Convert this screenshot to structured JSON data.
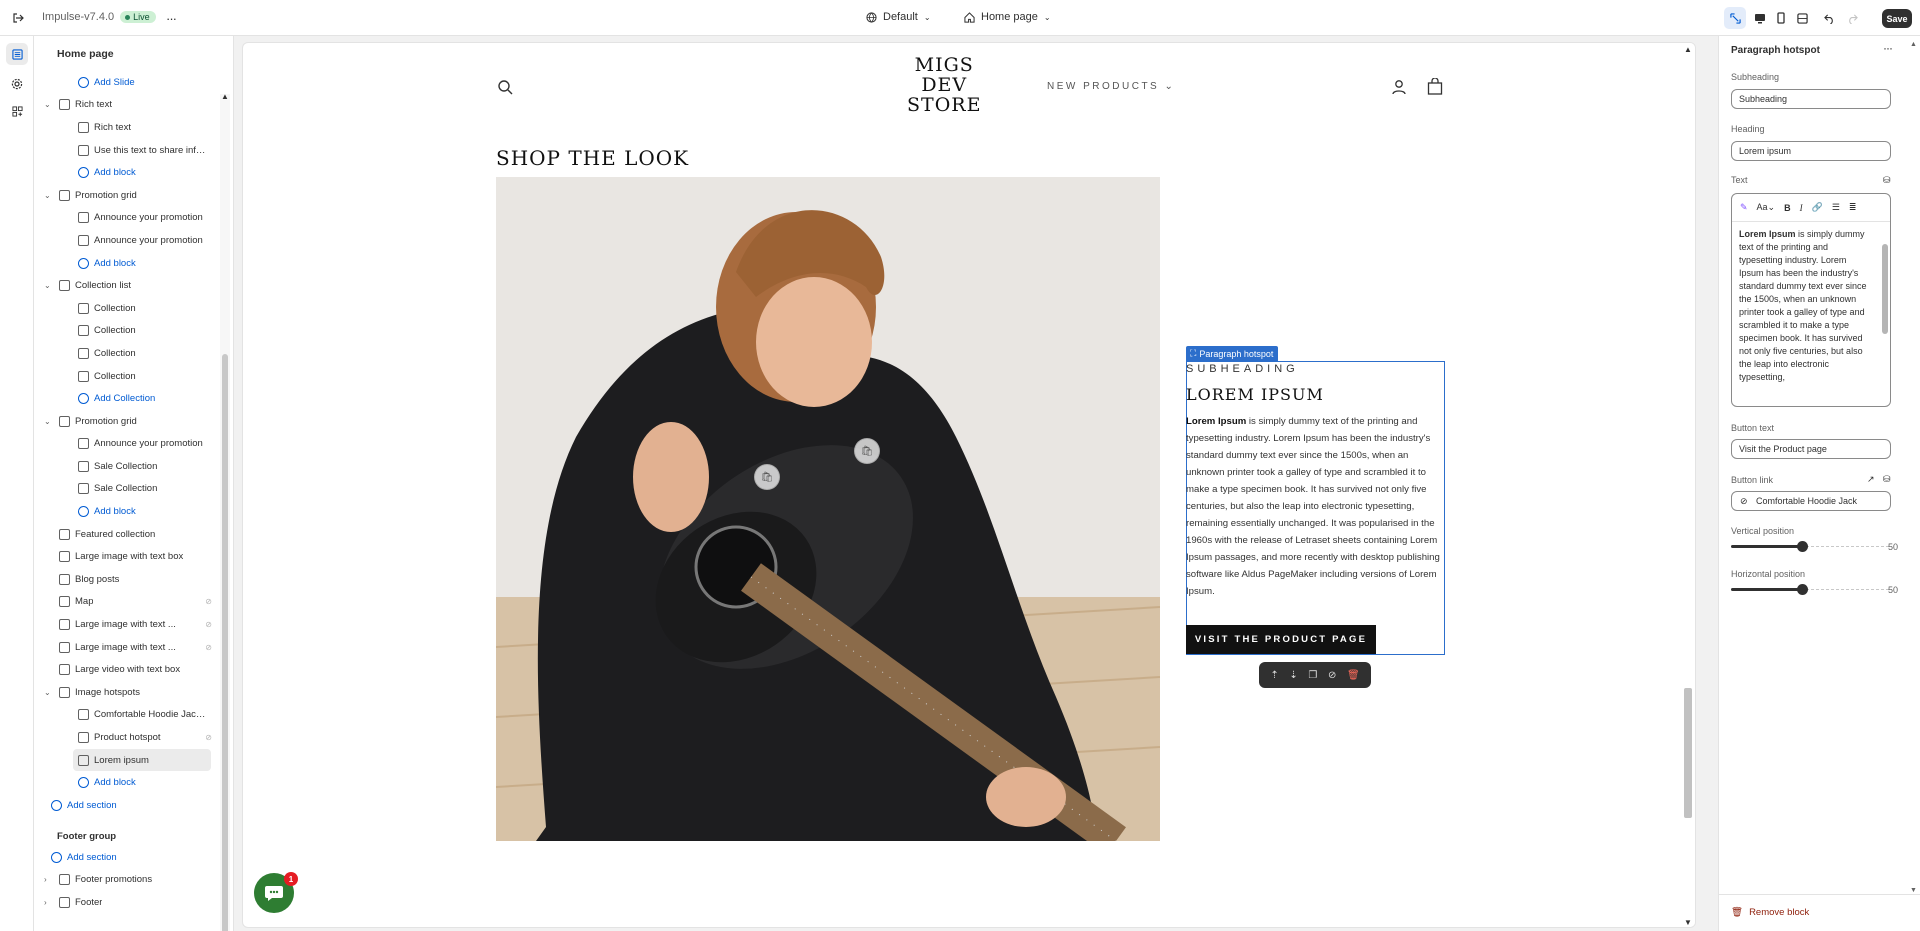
{
  "topbar": {
    "theme_name": "Impulse-v7.4.0",
    "live_badge": "Live",
    "locale": "Default",
    "page_select": "Home page",
    "save_label": "Save"
  },
  "sidebar": {
    "title": "Home page",
    "tree": [
      {
        "level": 2,
        "kind": "add",
        "label": "Add Slide"
      },
      {
        "level": 1,
        "kind": "section",
        "label": "Rich text",
        "expanded": true
      },
      {
        "level": 2,
        "kind": "block",
        "label": "Rich text"
      },
      {
        "level": 2,
        "kind": "block",
        "label": "Use this text to share info..."
      },
      {
        "level": 2,
        "kind": "add",
        "label": "Add block"
      },
      {
        "level": 1,
        "kind": "section",
        "label": "Promotion grid",
        "expanded": true
      },
      {
        "level": 2,
        "kind": "block",
        "label": "Announce your promotion"
      },
      {
        "level": 2,
        "kind": "block",
        "label": "Announce your promotion"
      },
      {
        "level": 2,
        "kind": "add",
        "label": "Add block"
      },
      {
        "level": 1,
        "kind": "section",
        "label": "Collection list",
        "expanded": true
      },
      {
        "level": 2,
        "kind": "block",
        "label": "Collection"
      },
      {
        "level": 2,
        "kind": "block",
        "label": "Collection"
      },
      {
        "level": 2,
        "kind": "block",
        "label": "Collection"
      },
      {
        "level": 2,
        "kind": "block",
        "label": "Collection"
      },
      {
        "level": 2,
        "kind": "add",
        "label": "Add Collection"
      },
      {
        "level": 1,
        "kind": "section",
        "label": "Promotion grid",
        "expanded": true
      },
      {
        "level": 2,
        "kind": "block",
        "label": "Announce your promotion"
      },
      {
        "level": 2,
        "kind": "block",
        "label": "Sale Collection"
      },
      {
        "level": 2,
        "kind": "block",
        "label": "Sale Collection"
      },
      {
        "level": 2,
        "kind": "add",
        "label": "Add block"
      },
      {
        "level": 1,
        "kind": "section-flat",
        "label": "Featured collection"
      },
      {
        "level": 1,
        "kind": "section-flat",
        "label": "Large image with text box"
      },
      {
        "level": 1,
        "kind": "section-flat",
        "label": "Blog posts"
      },
      {
        "level": 1,
        "kind": "section-flat",
        "label": "Map",
        "hidden": true
      },
      {
        "level": 1,
        "kind": "section-flat",
        "label": "Large image with text ...",
        "hidden": true
      },
      {
        "level": 1,
        "kind": "section-flat",
        "label": "Large image with text ...",
        "hidden": true
      },
      {
        "level": 1,
        "kind": "section-flat",
        "label": "Large video with text box"
      },
      {
        "level": 1,
        "kind": "section",
        "label": "Image hotspots",
        "expanded": true
      },
      {
        "level": 2,
        "kind": "block",
        "label": "Comfortable Hoodie Jack..."
      },
      {
        "level": 2,
        "kind": "block",
        "label": "Product hotspot",
        "hidden": true
      },
      {
        "level": 2,
        "kind": "block",
        "label": "Lorem ipsum",
        "selected": true
      },
      {
        "level": 2,
        "kind": "add",
        "label": "Add block"
      },
      {
        "level": 0,
        "kind": "add",
        "label": "Add section"
      }
    ],
    "footer_group": {
      "title": "Footer group",
      "add_section": "Add section",
      "items": [
        "Footer promotions",
        "Footer"
      ]
    }
  },
  "store": {
    "logo": "MIGS\nDEV\nSTORE",
    "nav_item": "NEW PRODUCTS",
    "section_title": "SHOP THE LOOK",
    "hotspot_tag": "Paragraph hotspot",
    "subheading": "SUBHEADING",
    "heading": "LOREM IPSUM",
    "text_bold": "Lorem Ipsum",
    "text_rest": " is simply dummy text of the printing and typesetting industry. Lorem Ipsum has been the industry's standard dummy text ever since the 1500s, when an unknown printer took a galley of type and scrambled it to make a type specimen book. It has survived not only five centuries, but also the leap into electronic typesetting, remaining essentially unchanged. It was popularised in the 1960s with the release of Letraset sheets containing Lorem Ipsum passages, and more recently with desktop publishing software like Aldus PageMaker including versions of Lorem Ipsum.",
    "button_label": "VISIT THE PRODUCT PAGE",
    "chat_badge": "1"
  },
  "settings": {
    "title": "Paragraph hotspot",
    "subheading_label": "Subheading",
    "subheading_value": "Subheading",
    "heading_label": "Heading",
    "heading_value": "Lorem ipsum",
    "text_label": "Text",
    "rte_text_bold": "Lorem Ipsum",
    "rte_text_rest": " is simply dummy text of the printing and typesetting industry. Lorem Ipsum has been the industry's standard dummy text ever since the 1500s, when an unknown printer took a galley of type and scrambled it to make a type specimen book. It has survived not only five centuries, but also the leap into electronic typesetting,",
    "button_text_label": "Button text",
    "button_text_value": "Visit the Product page",
    "button_link_label": "Button link",
    "button_link_value": "Comfortable Hoodie Jack",
    "vertical_label": "Vertical position",
    "vertical_value": "50",
    "horizontal_label": "Horizontal position",
    "horizontal_value": "50",
    "remove_label": "Remove block"
  },
  "colors": {
    "accent": "#2c6ecb",
    "link": "#005bd3",
    "live_badge_bg": "#cdf0d4",
    "danger": "#8e1f0b",
    "chat": "#2e7d32"
  }
}
